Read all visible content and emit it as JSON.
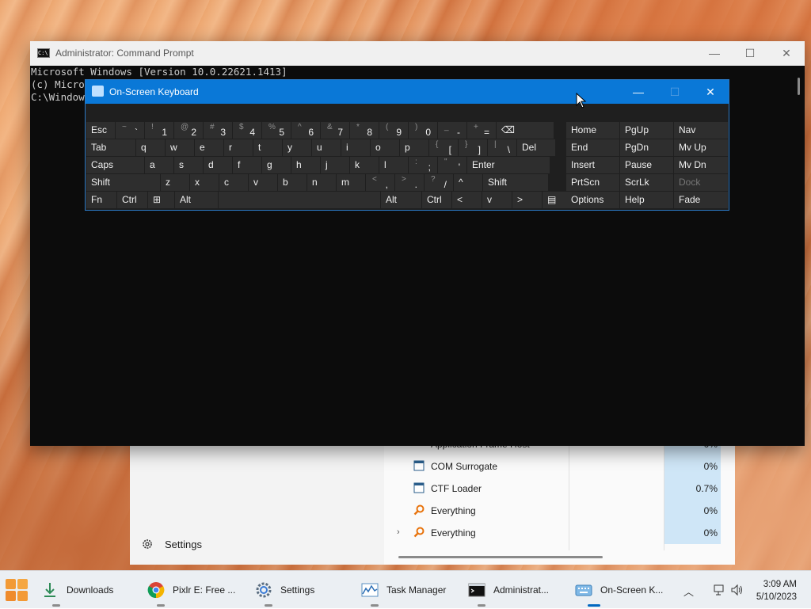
{
  "taskmanager": {
    "rows": [
      {
        "name": "Application Frame Host",
        "cpu": "0%",
        "icon": "window-icon",
        "expand": false
      },
      {
        "name": "COM Surrogate",
        "cpu": "0%",
        "icon": "window-icon",
        "expand": false
      },
      {
        "name": "CTF Loader",
        "cpu": "0.7%",
        "icon": "window-icon",
        "expand": false
      },
      {
        "name": "Everything",
        "cpu": "0%",
        "icon": "magnifier-icon",
        "expand": false
      },
      {
        "name": "Everything",
        "cpu": "0%",
        "icon": "magnifier-icon",
        "expand": true
      }
    ],
    "settings_label": "Settings"
  },
  "cmd": {
    "title": "Administrator: Command Prompt",
    "lines": [
      "Microsoft Windows [Version 10.0.22621.1413]",
      "(c) Micro",
      "",
      "C:\\Window"
    ]
  },
  "osk": {
    "title": "On-Screen Keyboard",
    "rows": [
      [
        {
          "label": "Esc"
        },
        {
          "shift": "~",
          "main": "`"
        },
        {
          "shift": "!",
          "main": "1"
        },
        {
          "shift": "@",
          "main": "2"
        },
        {
          "shift": "#",
          "main": "3"
        },
        {
          "shift": "$",
          "main": "4"
        },
        {
          "shift": "%",
          "main": "5"
        },
        {
          "shift": "^",
          "main": "6"
        },
        {
          "shift": "&",
          "main": "7"
        },
        {
          "shift": "*",
          "main": "8"
        },
        {
          "shift": "(",
          "main": "9"
        },
        {
          "shift": ")",
          "main": "0"
        },
        {
          "shift": "_",
          "main": "-"
        },
        {
          "shift": "+",
          "main": "="
        },
        {
          "label": "⌫"
        }
      ],
      [
        {
          "label": "Tab"
        },
        {
          "label": "q"
        },
        {
          "label": "w"
        },
        {
          "label": "e"
        },
        {
          "label": "r"
        },
        {
          "label": "t"
        },
        {
          "label": "y"
        },
        {
          "label": "u"
        },
        {
          "label": "i"
        },
        {
          "label": "o"
        },
        {
          "label": "p"
        },
        {
          "shift": "{",
          "main": "["
        },
        {
          "shift": "}",
          "main": "]"
        },
        {
          "shift": "|",
          "main": "\\"
        },
        {
          "label": "Del"
        }
      ],
      [
        {
          "label": "Caps"
        },
        {
          "label": "a"
        },
        {
          "label": "s"
        },
        {
          "label": "d"
        },
        {
          "label": "f"
        },
        {
          "label": "g"
        },
        {
          "label": "h"
        },
        {
          "label": "j"
        },
        {
          "label": "k"
        },
        {
          "label": "l"
        },
        {
          "shift": ":",
          "main": ";"
        },
        {
          "shift": "\"",
          "main": "'"
        },
        {
          "label": "Enter"
        }
      ],
      [
        {
          "label": "Shift"
        },
        {
          "label": "z"
        },
        {
          "label": "x"
        },
        {
          "label": "c"
        },
        {
          "label": "v"
        },
        {
          "label": "b"
        },
        {
          "label": "n"
        },
        {
          "label": "m"
        },
        {
          "shift": "<",
          "main": ","
        },
        {
          "shift": ">",
          "main": "."
        },
        {
          "shift": "?",
          "main": "/"
        },
        {
          "label": "^"
        },
        {
          "label": "Shift"
        }
      ],
      [
        {
          "label": "Fn"
        },
        {
          "label": "Ctrl"
        },
        {
          "label": "⊞"
        },
        {
          "label": "Alt"
        },
        {
          "label": ""
        },
        {
          "label": "Alt"
        },
        {
          "label": "Ctrl"
        },
        {
          "label": "<"
        },
        {
          "label": "v"
        },
        {
          "label": ">"
        },
        {
          "label": "▤"
        }
      ]
    ],
    "nav": [
      [
        "Home",
        "PgUp",
        "Nav"
      ],
      [
        "End",
        "PgDn",
        "Mv Up"
      ],
      [
        "Insert",
        "Pause",
        "Mv Dn"
      ],
      [
        "PrtScn",
        "ScrLk",
        "Dock"
      ],
      [
        "Options",
        "Help",
        "Fade"
      ]
    ]
  },
  "taskbar": {
    "items": [
      {
        "label": "Downloads",
        "icon": "download-icon"
      },
      {
        "label": "Pixlr E: Free ...",
        "icon": "chrome-icon"
      },
      {
        "label": "Settings",
        "icon": "gear-icon"
      },
      {
        "label": "Task Manager",
        "icon": "task-manager-icon"
      },
      {
        "label": "Administrat...",
        "icon": "cmd-icon"
      },
      {
        "label": "On-Screen K...",
        "icon": "keyboard-icon"
      }
    ],
    "time": "3:09 AM",
    "date": "5/10/2023"
  }
}
